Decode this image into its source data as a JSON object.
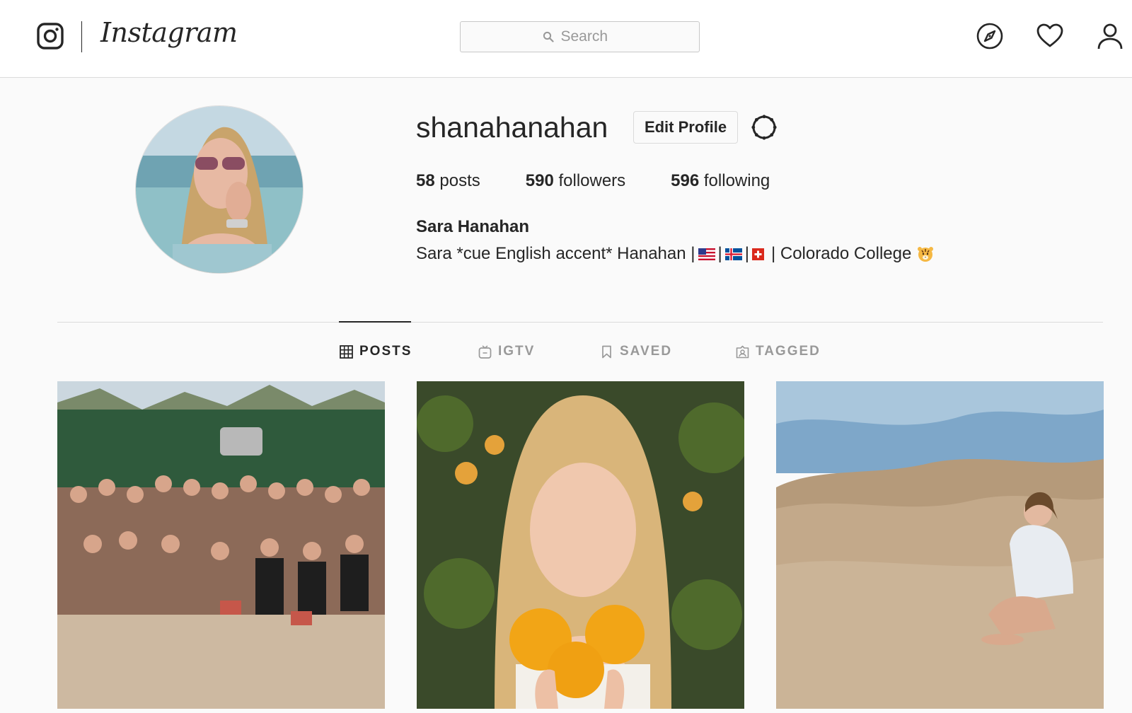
{
  "header": {
    "wordmark": "Instagram",
    "search": {
      "placeholder": "Search"
    },
    "icons": [
      "instagram-glyph-icon",
      "search-icon",
      "compass-icon",
      "heart-icon",
      "person-icon"
    ]
  },
  "profile": {
    "username": "shanahanahan",
    "edit_button": "Edit Profile",
    "stats": {
      "posts_count": "58",
      "posts_label": "posts",
      "followers_count": "590",
      "followers_label": "followers",
      "following_count": "596",
      "following_label": "following"
    },
    "full_name": "Sara Hanahan",
    "bio": {
      "prefix": "Sara *cue English accent* Hanahan |",
      "sep1": "|",
      "sep2": "|",
      "suffix": "| Colorado College",
      "emoji": [
        "us-flag",
        "iceland-flag",
        "switzerland-flag",
        "tiger-face"
      ]
    }
  },
  "tabs": [
    {
      "label": "POSTS",
      "icon": "grid-icon",
      "active": true
    },
    {
      "label": "IGTV",
      "icon": "igtv-icon",
      "active": false
    },
    {
      "label": "SAVED",
      "icon": "bookmark-icon",
      "active": false
    },
    {
      "label": "TAGGED",
      "icon": "tagged-icon",
      "active": false
    }
  ],
  "colors": {
    "text": "#262626",
    "muted": "#999999",
    "border": "#dbdbdb",
    "background": "#fafafa"
  }
}
